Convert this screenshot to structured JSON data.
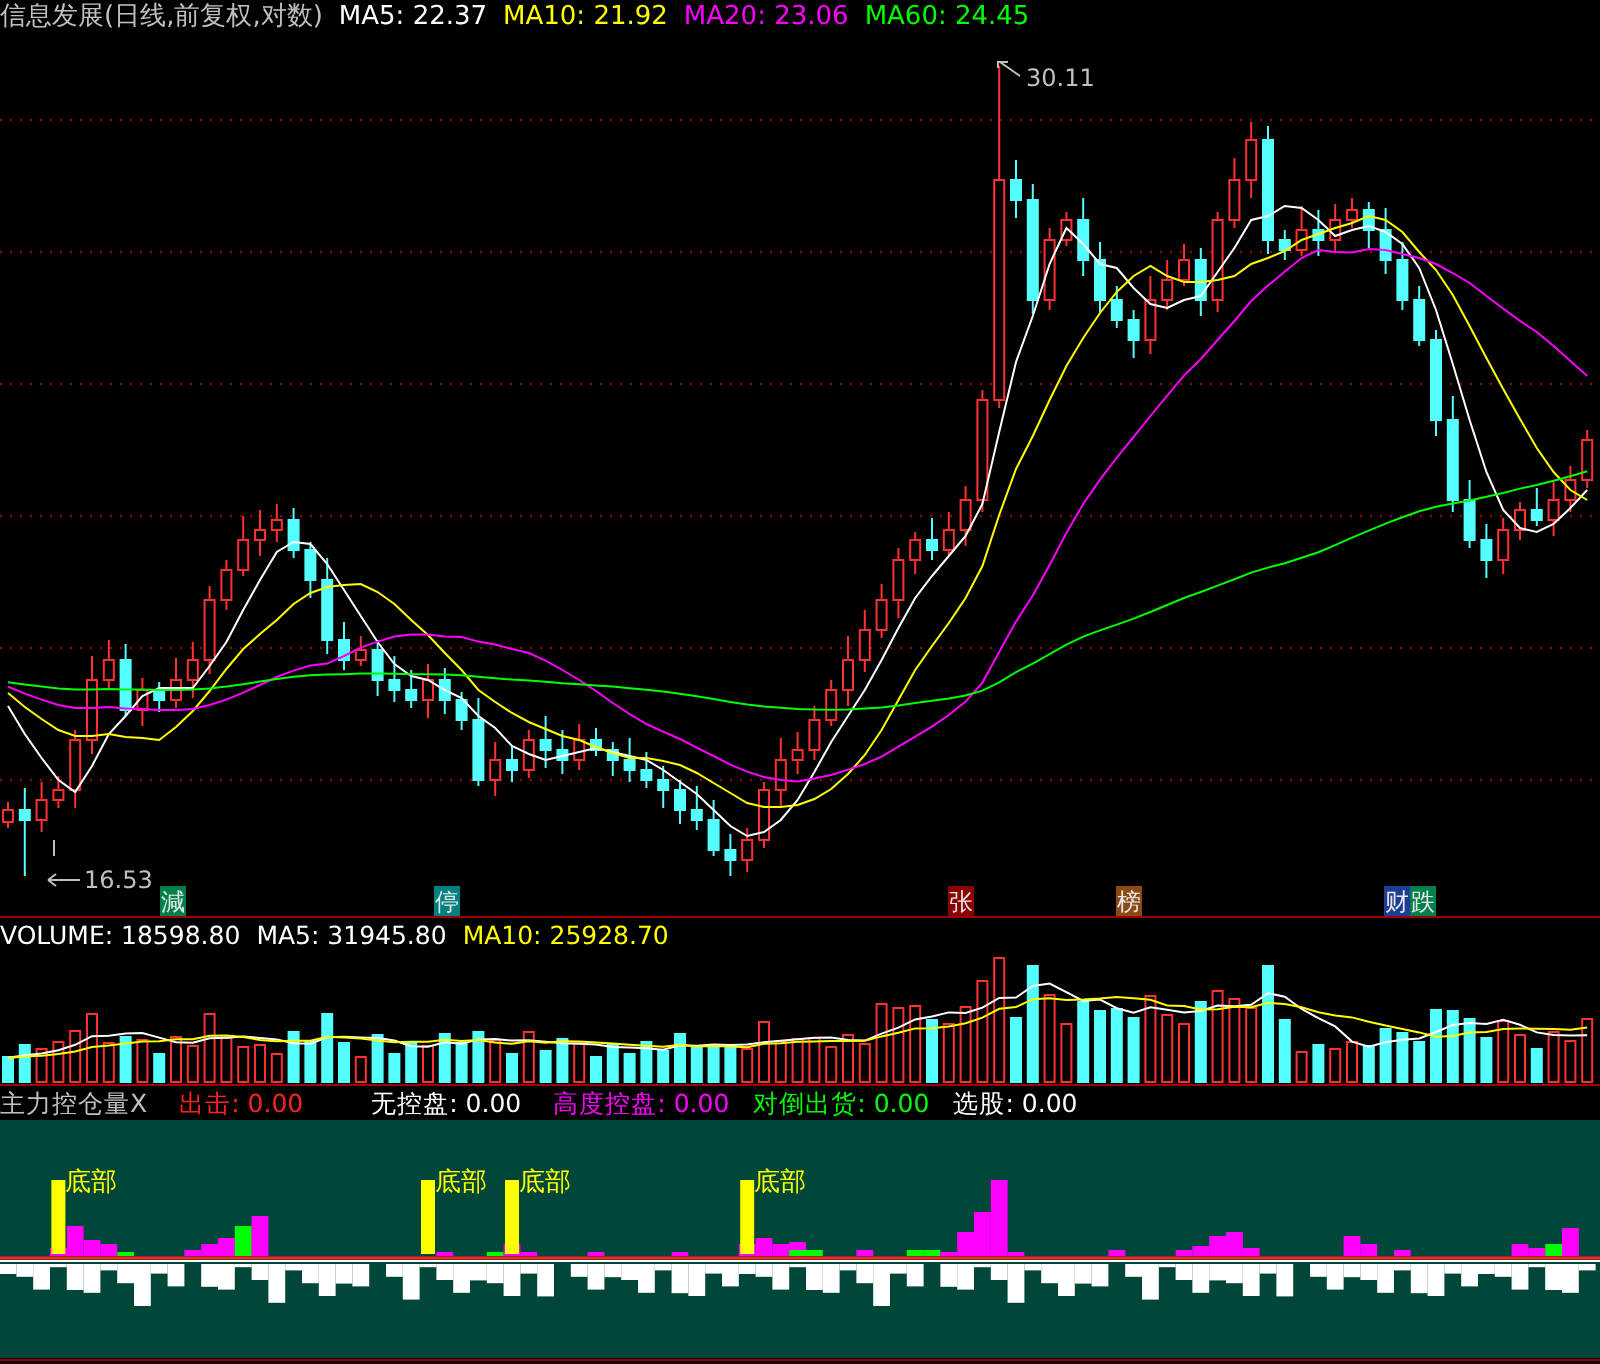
{
  "price_panel": {
    "title": "信息发展(日线,前复权,对数)",
    "moving_averages": [
      {
        "label": "MA5: 22.37",
        "color": "#ffffff"
      },
      {
        "label": "MA10: 21.92",
        "color": "#ffff00"
      },
      {
        "label": "MA20: 23.06",
        "color": "#ff00ff"
      },
      {
        "label": "MA60: 24.45",
        "color": "#00ff00"
      }
    ],
    "high_label": "30.11",
    "low_label": "16.53",
    "event_markers": [
      {
        "text": "減",
        "color": "#00804a"
      },
      {
        "text": "停",
        "color": "#008080"
      },
      {
        "text": "张",
        "color": "#8b0000"
      },
      {
        "text": "榜",
        "color": "#8b4a14"
      },
      {
        "text": "财",
        "color": "#1c3c96"
      },
      {
        "text": "跌",
        "color": "#00804a"
      }
    ]
  },
  "volume_panel": {
    "readings": [
      {
        "label": "VOLUME: 18598.80",
        "color": "#ffffff"
      },
      {
        "label": "MA5: 31945.80",
        "color": "#ffffff"
      },
      {
        "label": "MA10: 25928.70",
        "color": "#ffff00"
      }
    ]
  },
  "indicator_panel": {
    "title": "主力控仓量X",
    "readings": [
      {
        "label": "出击: 0.00",
        "color": "#ff2020"
      },
      {
        "label": "无控盘: 0.00",
        "color": "#ffffff"
      },
      {
        "label": "高度控盘: 0.00",
        "color": "#ff00ff"
      },
      {
        "label": "对倒出货: 0.00",
        "color": "#00ff00"
      },
      {
        "label": "选股: 0.00",
        "color": "#ffffff"
      }
    ],
    "signal_labels": [
      "底部",
      "底部",
      "底部",
      "底部"
    ]
  }
}
